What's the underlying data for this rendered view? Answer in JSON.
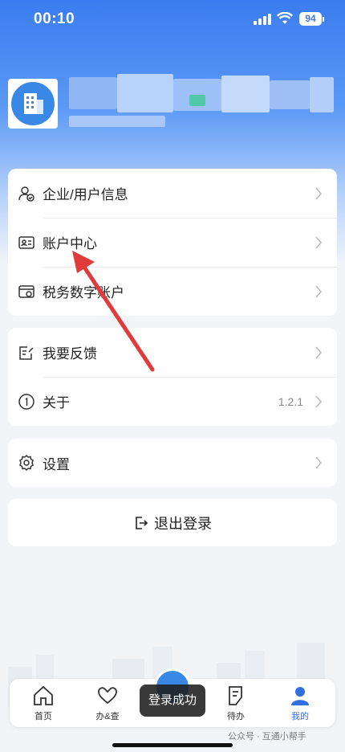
{
  "status_bar": {
    "time": "00:10",
    "battery": "94"
  },
  "menu_group_1": [
    {
      "label": "企业/用户信息",
      "icon": "user-check-icon"
    },
    {
      "label": "账户中心",
      "icon": "id-card-icon"
    },
    {
      "label": "税务数字账户",
      "icon": "tax-account-icon"
    }
  ],
  "menu_group_2": [
    {
      "label": "我要反馈",
      "icon": "feedback-edit-icon"
    },
    {
      "label": "关于",
      "icon": "info-icon",
      "value": "1.2.1"
    }
  ],
  "menu_group_3": [
    {
      "label": "设置",
      "icon": "gear-icon"
    }
  ],
  "logout": {
    "label": "退出登录"
  },
  "tabbar": [
    {
      "label": "首页",
      "icon": "home-icon"
    },
    {
      "label": "办&查",
      "icon": "heart-hands-icon"
    },
    {
      "label": "待办",
      "icon": "todo-list-icon"
    },
    {
      "label": "我的",
      "icon": "profile-icon",
      "active": true
    }
  ],
  "toast": {
    "text": "登录成功"
  },
  "watermark": {
    "text": "公众号 · 互通小帮手"
  },
  "colors": {
    "primary": "#3b7cf0",
    "active_tab": "#2f6fe0",
    "arrow": "#e03a3a"
  }
}
